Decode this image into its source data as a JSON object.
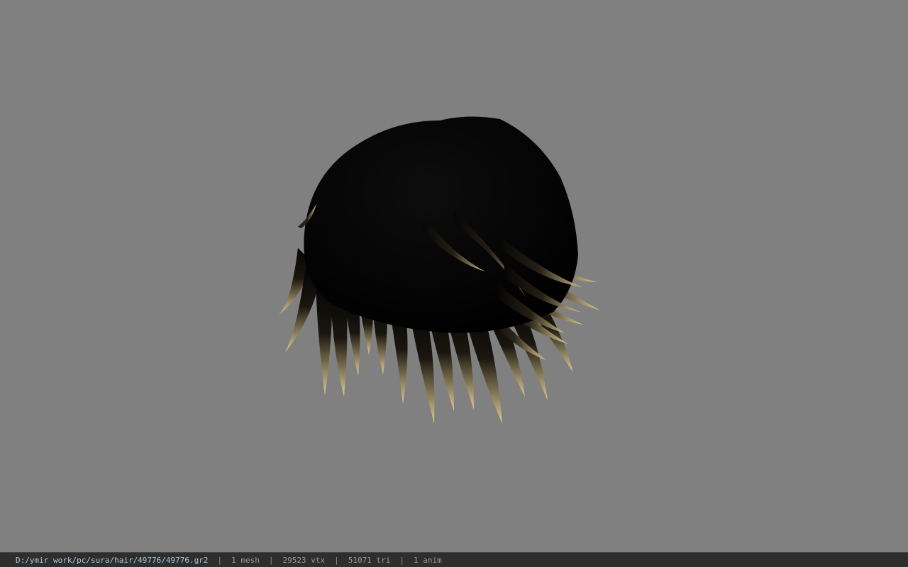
{
  "viewer": {
    "background_color": "#808080",
    "model_icon": "hair-mesh-model"
  },
  "status": {
    "file_path": "D:/ymir work/pc/sura/hair/49776/49776.gr2",
    "separator": "|",
    "mesh_count": "1 mesh",
    "vertex_count": "29523 vtx",
    "triangle_count": "51071 tri",
    "anim_count": "1 anim"
  }
}
